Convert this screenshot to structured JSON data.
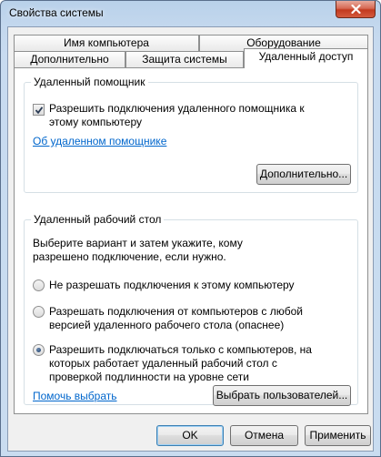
{
  "window": {
    "title": "Свойства системы"
  },
  "tabs": {
    "row1": [
      {
        "label": "Имя компьютера"
      },
      {
        "label": "Оборудование"
      }
    ],
    "row2": [
      {
        "label": "Дополнительно"
      },
      {
        "label": "Защита системы"
      },
      {
        "label": "Удаленный доступ",
        "active": true
      }
    ]
  },
  "remote_assistance": {
    "group_label": "Удаленный помощник",
    "checkbox_label": "Разрешить подключения удаленного помощника к этому компьютеру",
    "checkbox_checked": true,
    "link": "Об удаленном помощнике",
    "advanced_button": "Дополнительно..."
  },
  "remote_desktop": {
    "group_label": "Удаленный рабочий стол",
    "instruction": "Выберите вариант и затем укажите, кому разрешено подключение, если нужно.",
    "options": [
      {
        "label": "Не разрешать подключения к этому компьютеру",
        "selected": false
      },
      {
        "label": "Разрешать подключения от компьютеров с любой версией удаленного рабочего стола (опаснее)",
        "selected": false
      },
      {
        "label": "Разрешить подключаться только с компьютеров, на которых работает удаленный рабочий стол с проверкой подлинности на уровне сети",
        "selected": true
      }
    ],
    "help_link": "Помочь выбрать",
    "select_users_button": "Выбрать пользователей..."
  },
  "footer": {
    "ok": "OK",
    "cancel": "Отмена",
    "apply": "Применить"
  },
  "colors": {
    "link": "#0066cc",
    "frame": "#c4d8ee",
    "close_button": "#c2391f"
  },
  "icons": {
    "close": "close-icon",
    "check": "checkmark-icon"
  }
}
